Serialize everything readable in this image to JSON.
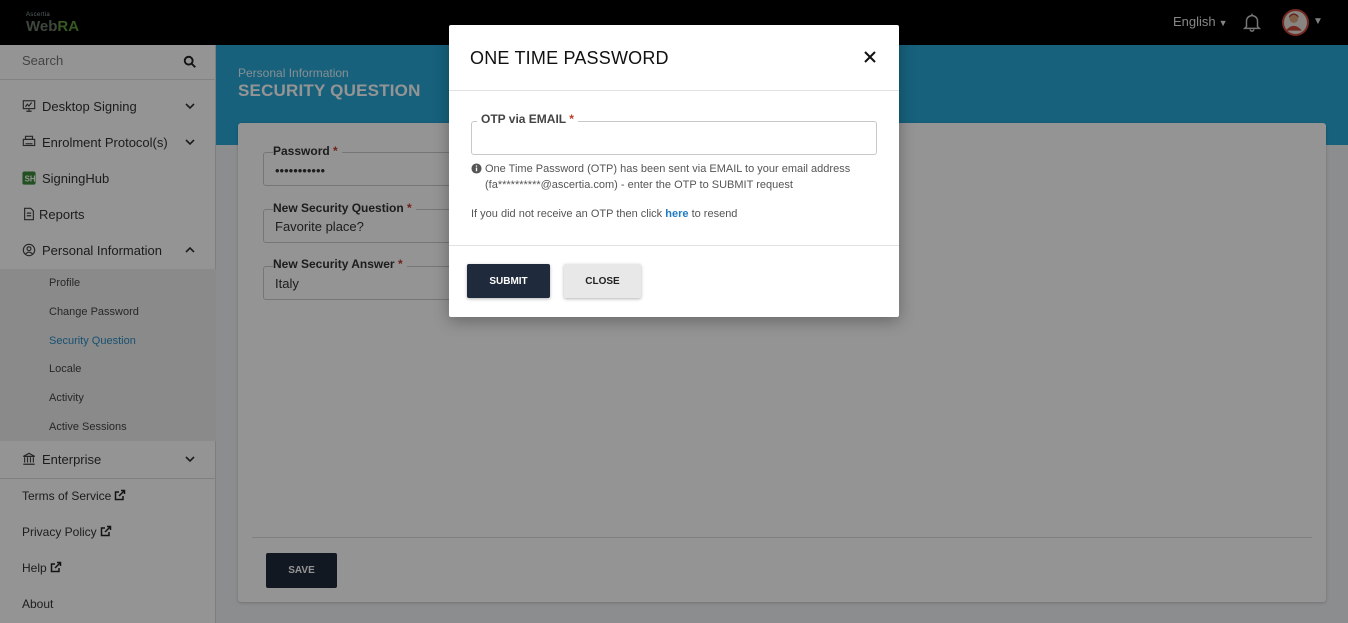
{
  "topbar": {
    "logo_small": "Ascertia",
    "logo_web": "Web",
    "logo_ra": "RA",
    "language": "English"
  },
  "sidebar": {
    "search_placeholder": "Search",
    "items": [
      {
        "label": "Desktop Signing",
        "icon": "desktop-icon"
      },
      {
        "label": "Enrolment Protocol(s)",
        "icon": "printer-icon"
      },
      {
        "label": "SigningHub",
        "icon": "signinghub-icon"
      },
      {
        "label": "Reports",
        "icon": "document-icon"
      },
      {
        "label": "Personal Information",
        "icon": "user-circle-icon"
      },
      {
        "label": "Enterprise",
        "icon": "bank-icon"
      }
    ],
    "submenu": [
      "Profile",
      "Change Password",
      "Security Question",
      "Locale",
      "Activity",
      "Active Sessions"
    ],
    "active_submenu": "Security Question",
    "footer_links": [
      "Terms of Service",
      "Privacy Policy",
      "Help",
      "About"
    ]
  },
  "main": {
    "breadcrumb": "Personal Information",
    "title": "SECURITY QUESTION",
    "fields": [
      {
        "label": "Password",
        "value": "•••••••••••"
      },
      {
        "label": "New Security Question",
        "value": "Favorite place?"
      },
      {
        "label": "New Security Answer",
        "value": "Italy"
      }
    ],
    "save_label": "SAVE"
  },
  "modal": {
    "title": "ONE TIME PASSWORD",
    "otp_label": "OTP via EMAIL",
    "otp_value": "",
    "info_line1": "One Time Password (OTP) has been sent via EMAIL to your email address",
    "info_line2": "(fa**********@ascertia.com) - enter the OTP to SUBMIT request",
    "resend_prefix": "If you did not receive an OTP then click",
    "resend_link": "here",
    "resend_suffix": "to resend",
    "submit_label": "SUBMIT",
    "close_label": "CLOSE"
  },
  "colors": {
    "accent": "#28a8d8",
    "button_dark": "#1f2a3c",
    "link": "#1f7bc4",
    "active_submenu": "#2b8cc4"
  }
}
